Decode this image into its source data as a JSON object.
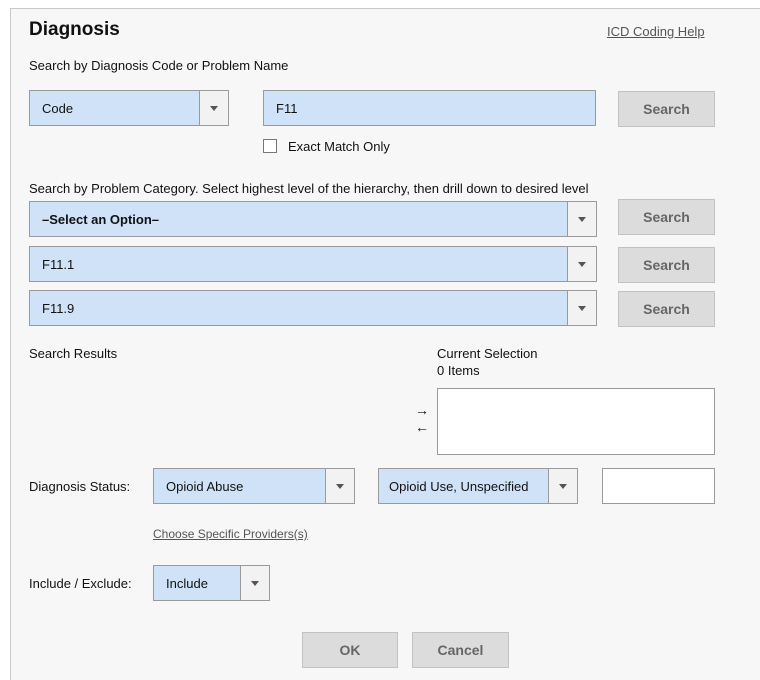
{
  "header": {
    "title": "Diagnosis",
    "help_link": "ICD Coding Help"
  },
  "code_search": {
    "label": "Search by Diagnosis Code or Problem Name",
    "mode_value": "Code",
    "query_value": "F11",
    "search_label": "Search",
    "exact_match_label": "Exact Match Only"
  },
  "category_search": {
    "label": "Search by Problem Category. Select highest level of the hierarchy, then drill down to desired level",
    "levels": [
      {
        "value": "–Select an Option–",
        "search_label": "Search"
      },
      {
        "value": "F11.1",
        "search_label": "Search"
      },
      {
        "value": "F11.9",
        "search_label": "Search"
      }
    ]
  },
  "results": {
    "label": "Search Results",
    "current_selection_label": "Current Selection",
    "items_count": "0 Items",
    "add_arrow": "→",
    "remove_arrow": "←"
  },
  "status": {
    "label": "Diagnosis Status:",
    "value1": "Opioid Abuse",
    "value2": "Opioid Use, Unspecified",
    "text_value": ""
  },
  "providers_link": "Choose Specific Providers(s)",
  "include_exclude": {
    "label": "Include / Exclude:",
    "value": "Include"
  },
  "footer": {
    "ok_label": "OK",
    "cancel_label": "Cancel"
  }
}
